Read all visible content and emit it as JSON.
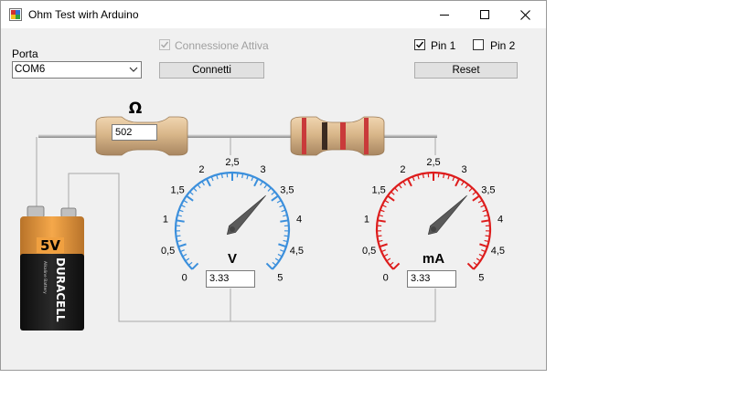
{
  "window": {
    "title": "Ohm Test wirh Arduino",
    "icon": "app-window-icon",
    "controls": {
      "minimize": "—",
      "maximize": "☐",
      "close": "✕"
    }
  },
  "port": {
    "label": "Porta",
    "selected": "COM6"
  },
  "connection": {
    "checkbox_label": "Connessione Attiva",
    "checked": true,
    "enabled": false,
    "connect_button": "Connetti"
  },
  "pins": {
    "pin1_label": "Pin 1",
    "pin1_checked": true,
    "pin2_label": "Pin 2",
    "pin2_checked": false,
    "reset_button": "Reset"
  },
  "resistor": {
    "symbol": "Ω",
    "value": "502"
  },
  "battery": {
    "voltage_label": "5V",
    "brand": "DURACELL",
    "fine_print": "Alkaline Battery"
  },
  "voltmeter": {
    "unit": "V",
    "value": "3.33",
    "reading": 3.33,
    "scale_min": 0,
    "scale_max": 5,
    "tick_labels": [
      "0",
      "0,5",
      "1",
      "1,5",
      "2",
      "2,5",
      "3",
      "3,5",
      "4",
      "4,5",
      "5"
    ],
    "color": "#3b8fdc"
  },
  "ammeter": {
    "unit": "mA",
    "value": "3.33",
    "reading": 3.33,
    "scale_min": 0,
    "scale_max": 5,
    "tick_labels": [
      "0",
      "0,5",
      "1",
      "1,5",
      "2",
      "2,5",
      "3",
      "3,5",
      "4",
      "4,5",
      "5"
    ],
    "color": "#dd1c1c"
  }
}
